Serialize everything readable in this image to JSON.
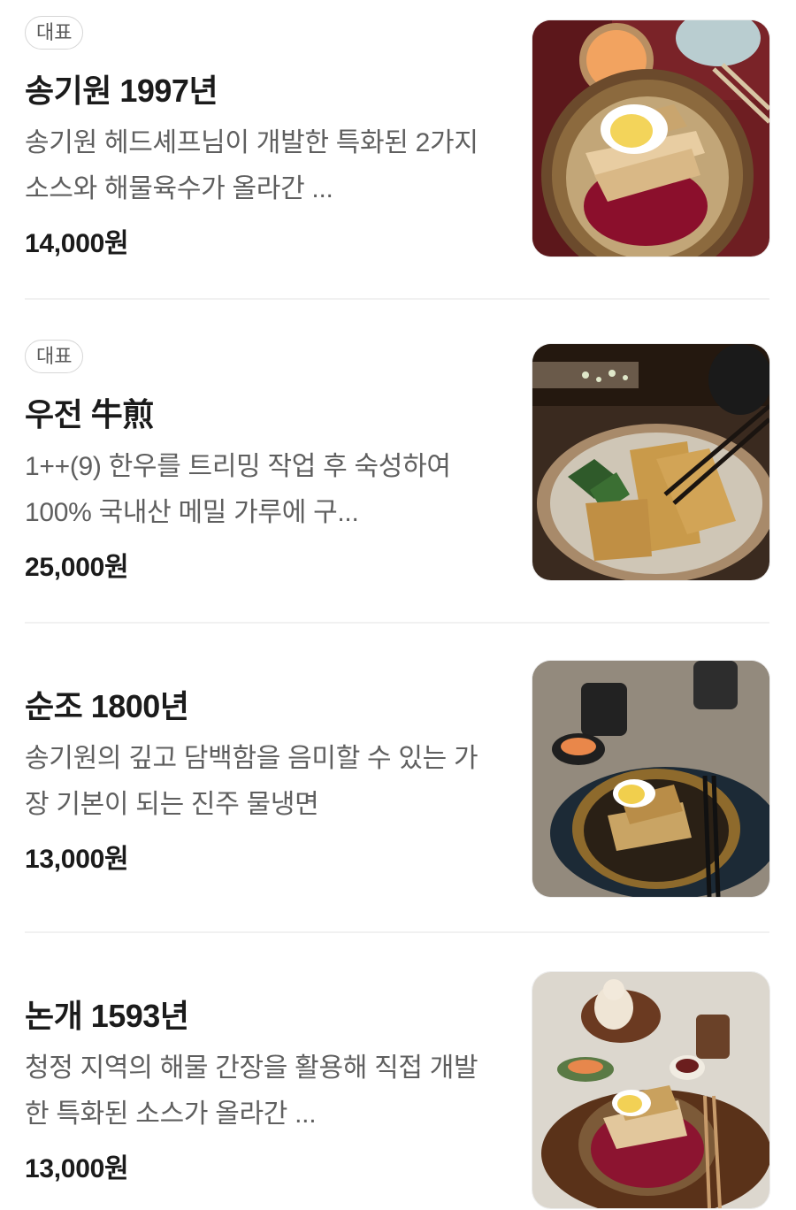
{
  "menu_items": [
    {
      "badge": "대표",
      "name": "송기원 1997년",
      "description": "송기원 헤드셰프님이 개발한 특화된 2가지 소스와 해물육수가 올라간 ...",
      "price": "14,000원"
    },
    {
      "badge": "대표",
      "name": "우전 牛煎",
      "description": "1++(9) 한우를 트리밍 작업 후 숙성하여 100% 국내산 메밀 가루에 구...",
      "price": "25,000원"
    },
    {
      "name": "순조 1800년",
      "description": "송기원의 깊고 담백함을 음미할 수 있는 가장 기본이 되는 진주 물냉면",
      "price": "13,000원"
    },
    {
      "name": "논개 1593년",
      "description": "청정 지역의 해물 간장을 활용해 직접 개발한 특화된 소스가 올라간 ...",
      "price": "13,000원"
    }
  ]
}
